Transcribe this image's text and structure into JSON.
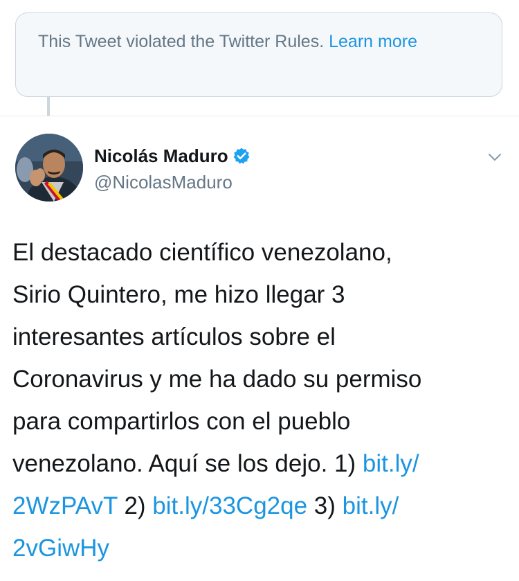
{
  "notice": {
    "text": "This Tweet violated the Twitter Rules.",
    "link_text": "Learn more"
  },
  "tweet": {
    "author": {
      "display_name": "Nicolás Maduro",
      "handle": "@NicolasMaduro",
      "verified": true
    },
    "lines": [
      {
        "segments": [
          {
            "text": "El destacado científico venezolano,",
            "link": false
          }
        ]
      },
      {
        "segments": [
          {
            "text": "Sirio Quintero, me hizo llegar 3",
            "link": false
          }
        ]
      },
      {
        "segments": [
          {
            "text": "interesantes artículos sobre el",
            "link": false
          }
        ]
      },
      {
        "segments": [
          {
            "text": "Coronavirus y me ha dado su permiso",
            "link": false
          }
        ]
      },
      {
        "segments": [
          {
            "text": "para compartirlos con el pueblo",
            "link": false
          }
        ]
      },
      {
        "segments": [
          {
            "text": "venezolano. Aquí se los dejo. 1) ",
            "link": false
          },
          {
            "text": "bit.ly/",
            "link": true
          }
        ]
      },
      {
        "segments": [
          {
            "text": "2WzPAvT",
            "link": true
          },
          {
            "text": " 2)  ",
            "link": false
          },
          {
            "text": "bit.ly/33Cg2qe",
            "link": true
          },
          {
            "text": " 3) ",
            "link": false
          },
          {
            "text": "bit.ly/",
            "link": true
          }
        ]
      },
      {
        "segments": [
          {
            "text": "2vGiwHy",
            "link": true
          }
        ]
      }
    ]
  },
  "icons": {
    "verified": "verified-badge-icon",
    "caret": "chevron-down-icon"
  },
  "colors": {
    "link": "#1b95e0",
    "secondary_text": "#657786",
    "primary_text": "#14171a",
    "notice_background": "#f5f8fa",
    "border": "#ccd6dd"
  }
}
